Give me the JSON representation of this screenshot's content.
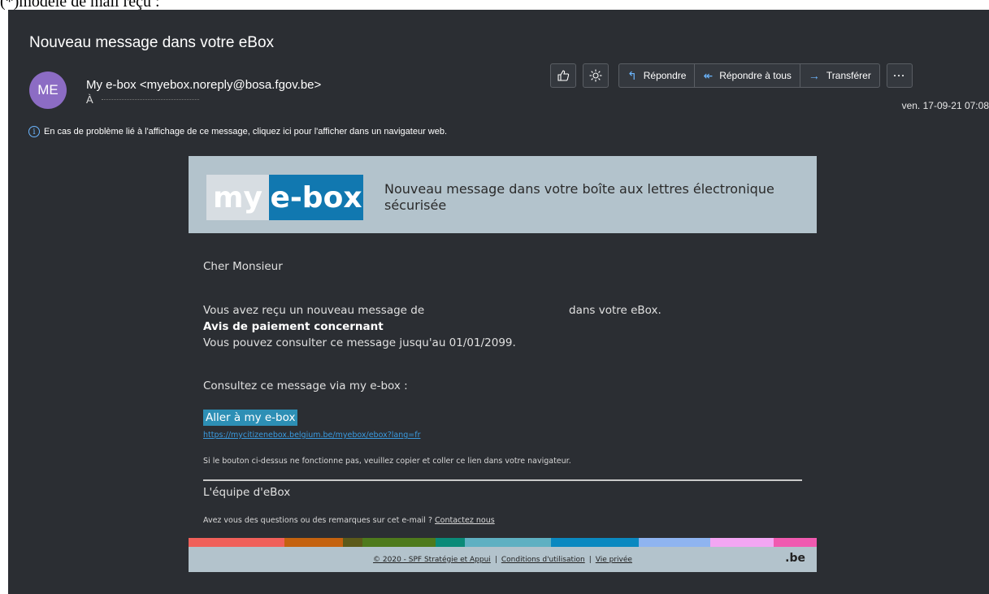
{
  "caption": "(*)modèle de mail reçu :",
  "message": {
    "subject": "Nouveau message dans votre eBox",
    "avatar_initials": "ME",
    "sender": "My e-box <myebox.noreply@bosa.fgov.be>",
    "to_label": "À",
    "date": "ven. 17-09-21 07:08",
    "info_text": "En cas de problème lié à l'affichage de ce message, cliquez ici pour l'afficher dans un navigateur web."
  },
  "toolbar": {
    "like_icon": "thumbs-up-icon",
    "theme_icon": "sun-icon",
    "reply": "Répondre",
    "reply_all": "Répondre à tous",
    "forward": "Transférer",
    "more": "···"
  },
  "mail": {
    "logo_my": "my",
    "logo_ebox": "e-box",
    "header_text": "Nouveau message dans votre boîte aux lettres électronique sécurisée",
    "greeting": "Cher Monsieur",
    "received_prefix": "Vous avez reçu un nouveau message de",
    "received_suffix": "dans votre eBox.",
    "subject_prefix": "Avis de paiement concernant",
    "consult_until": "Vous pouvez consulter ce message jusqu'au 01/01/2099.",
    "consult_via": "Consultez ce message via my e-box :",
    "cta": "Aller à my e-box",
    "link": "https://mycitizenebox.belgium.be/myebox/ebox?lang=fr",
    "fallback": "Si le bouton ci-dessus ne fonctionne pas, veuillez copier et coller ce lien dans votre navigateur.",
    "team": "L'équipe d'eBox",
    "questions": "Avez vous des questions ou des remarques sur cet e-mail ?",
    "contact": "Contactez nous"
  },
  "footer": {
    "copyright": "© 2020 - SPF Stratégie et Appui",
    "terms": "Conditions d'utilisation",
    "privacy": "Vie privée",
    "separator": "|",
    "be": ".be"
  },
  "colors": {
    "stripes": [
      "#f0605a",
      "#c4620f",
      "#5c5a1a",
      "#4e7a1c",
      "#0a8a78",
      "#5fb0c2",
      "#0a88c0",
      "#8fb4f0",
      "#f3a6f3",
      "#f05ab0"
    ]
  }
}
